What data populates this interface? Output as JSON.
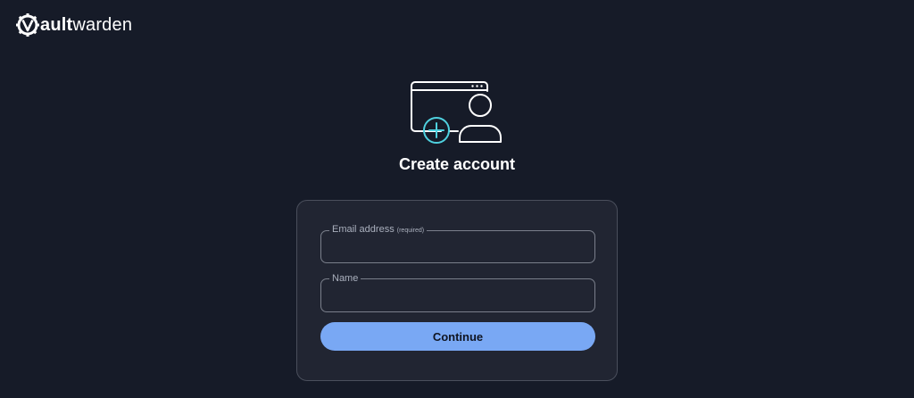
{
  "logo": {
    "text_bold": "ault",
    "text_light": "warden",
    "icon": "vaultwarden-gear-icon"
  },
  "hero": {
    "icon": "create-account-illustration-icon"
  },
  "page": {
    "title": "Create account"
  },
  "form": {
    "email": {
      "label": "Email address",
      "required_note": "(required)",
      "value": "",
      "placeholder": ""
    },
    "name": {
      "label": "Name",
      "value": "",
      "placeholder": ""
    },
    "continue_label": "Continue"
  },
  "colors": {
    "background": "#161b28",
    "card": "#212532",
    "accent_button": "#79a8f4",
    "accent_teal": "#4fd1df"
  }
}
